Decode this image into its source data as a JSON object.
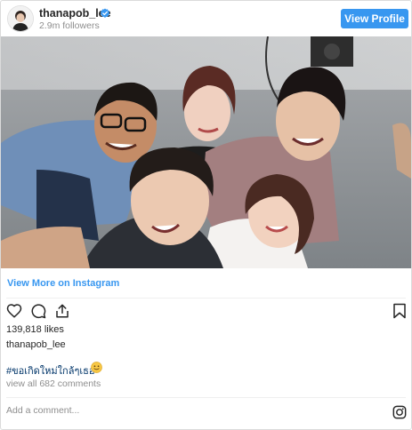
{
  "header": {
    "username": "thanapob_lee",
    "followers": "2.9m followers",
    "view_profile_label": "View Profile",
    "verified_icon": "verified-badge-icon"
  },
  "media": {
    "description_icon": "photo-icon"
  },
  "view_more_label": "View More on Instagram",
  "actions": {
    "like_icon": "heart-icon",
    "comment_icon": "comment-icon",
    "share_icon": "share-icon",
    "save_icon": "bookmark-icon"
  },
  "likes_text": "139,818 likes",
  "caption": {
    "username": "thanapob_lee",
    "hashtag": "#ขอเกิดใหม่ใกล้ๆเธอ",
    "emoji_icon": "smiling-face-emoji"
  },
  "comments_link": "view all 682 comments",
  "add_comment": {
    "placeholder": "Add a comment..."
  },
  "colors": {
    "accent": "#3897f0",
    "hashtag": "#003569",
    "muted": "#8e8e8e"
  }
}
